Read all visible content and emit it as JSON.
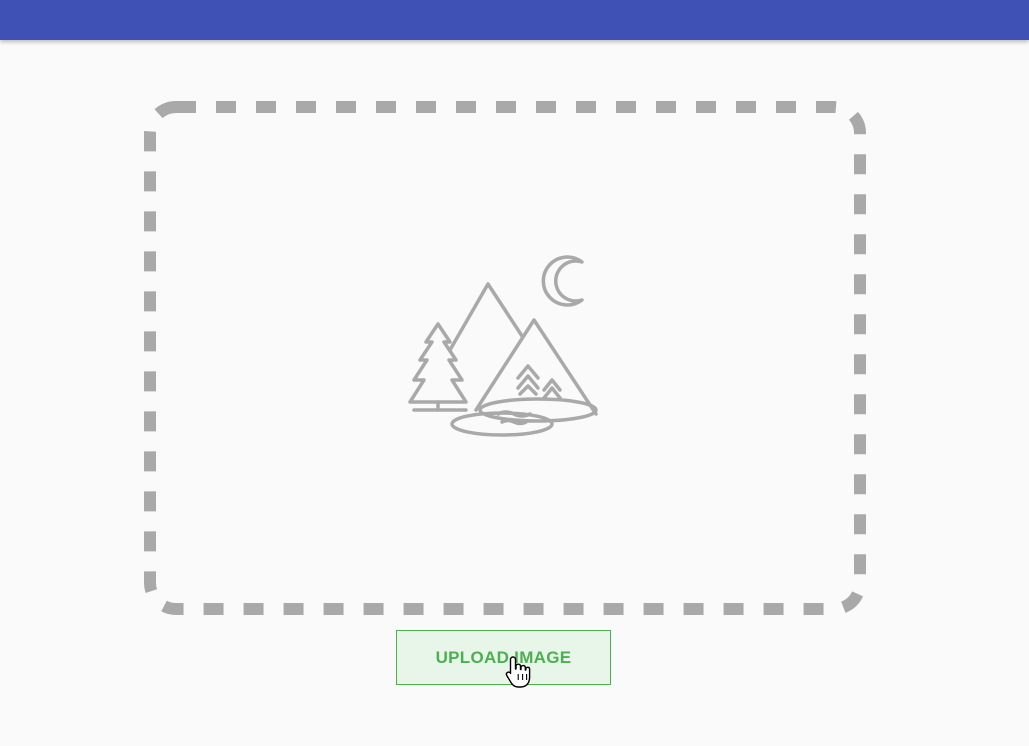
{
  "upload": {
    "button_label": "UPLOAD IMAGE"
  },
  "icons": {
    "placeholder": "image-placeholder-icon",
    "cursor": "hand-pointer-cursor-icon"
  },
  "colors": {
    "app_bar": "#3f51b5",
    "dropzone_border": "#a9a9a9",
    "illustration": "#a9a9a9",
    "button_text": "#4caf50",
    "button_background": "#e8f5e9",
    "background": "#fafafa"
  }
}
